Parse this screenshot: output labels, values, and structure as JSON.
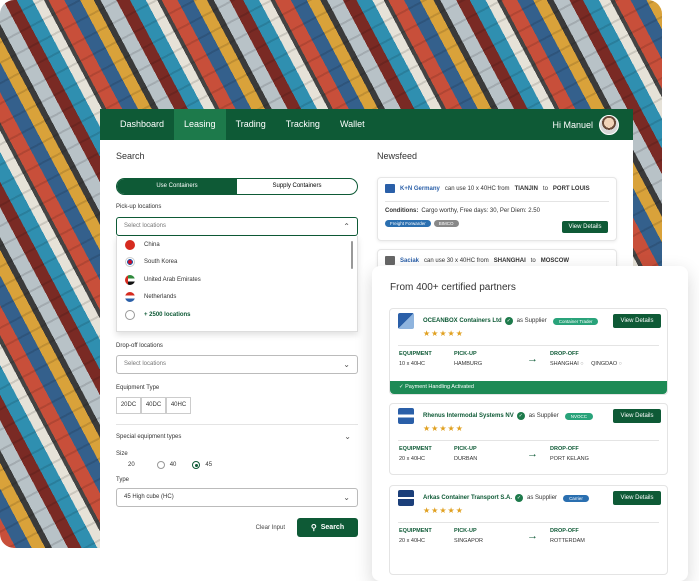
{
  "nav": {
    "items": [
      "Dashboard",
      "Leasing",
      "Trading",
      "Tracking",
      "Wallet"
    ],
    "active": "Leasing",
    "greeting": "Hi Manuel"
  },
  "search": {
    "title": "Search",
    "toggle": [
      "Use Containers",
      "Supply Containers"
    ],
    "pickup_label": "Pick-up locations",
    "pickup_placeholder": "Select locations",
    "pickup_options": [
      {
        "name": "China",
        "flag": "#d62b1f"
      },
      {
        "name": "South Korea",
        "flag": "#2a5fa8"
      },
      {
        "name": "United Arab Emirates",
        "flag": "#2f8a3c"
      },
      {
        "name": "Netherlands",
        "flag": "#d62b1f"
      }
    ],
    "pickup_more": "+ 2500 locations",
    "dropoff_label": "Drop-off locations",
    "dropoff_placeholder": "Select locations",
    "equipment_label": "Equipment Type",
    "equipment_options": [
      "20DC",
      "40DC",
      "40HC"
    ],
    "special_label": "Special equipment types",
    "size_label": "Size",
    "sizes": [
      "20",
      "40",
      "45"
    ],
    "size_selected": "45",
    "type_label": "Type",
    "type_value": "45 High cube (HC)",
    "clear_label": "Clear Input",
    "search_button": "Search"
  },
  "newsfeed": {
    "title": "Newsfeed",
    "card1": {
      "company": "K+N Germany",
      "text_pre": "can use 10 x 40HC from",
      "from": "TIANJIN",
      "to_word": "to",
      "to": "PORT LOUIS",
      "conditions_label": "Conditions:",
      "conditions": "Cargo worthy, Free days: 30, Per Diem: 2.50",
      "tags": [
        "Freight Forwarder",
        "BIMCO"
      ],
      "button": "View Details"
    },
    "card2": {
      "company": "Saciak",
      "text_pre": "can use 30 x 40HC from",
      "from": "SHANGHAI",
      "to_word": "to",
      "to": "MOSCOW"
    }
  },
  "partners": {
    "title": "From 400+ certified partners",
    "labels": {
      "equipment": "EQUIPMENT",
      "pickup": "PICK-UP",
      "dropoff": "DROP-OFF",
      "as_supplier": "as Supplier",
      "view": "View Details"
    },
    "cards": [
      {
        "name": "OCEANBOX Containers Ltd",
        "badge": "Container Trader",
        "badge_color": "#29a37a",
        "equipment": "10 x 40HC",
        "pickup": "HAMBURG",
        "dropoff": [
          "SHANGHAI",
          "QINGDAO"
        ],
        "stars": "★★★★★",
        "payment": "Payment Handling Activated"
      },
      {
        "name": "Rhenus Intermodal Systems NV",
        "badge": "NVOCC",
        "badge_color": "#29a37a",
        "equipment": "20 x 40HC",
        "pickup": "DURBAN",
        "dropoff": [
          "PORT KELANG"
        ],
        "stars": "★★★★★"
      },
      {
        "name": "Arkas Container Transport S.A.",
        "badge": "Carrier",
        "badge_color": "#2a6fb0",
        "equipment": "20 x 40HC",
        "pickup": "SINGAPOR",
        "dropoff": [
          "ROTTERDAM"
        ],
        "stars": "★★★★★"
      }
    ]
  }
}
